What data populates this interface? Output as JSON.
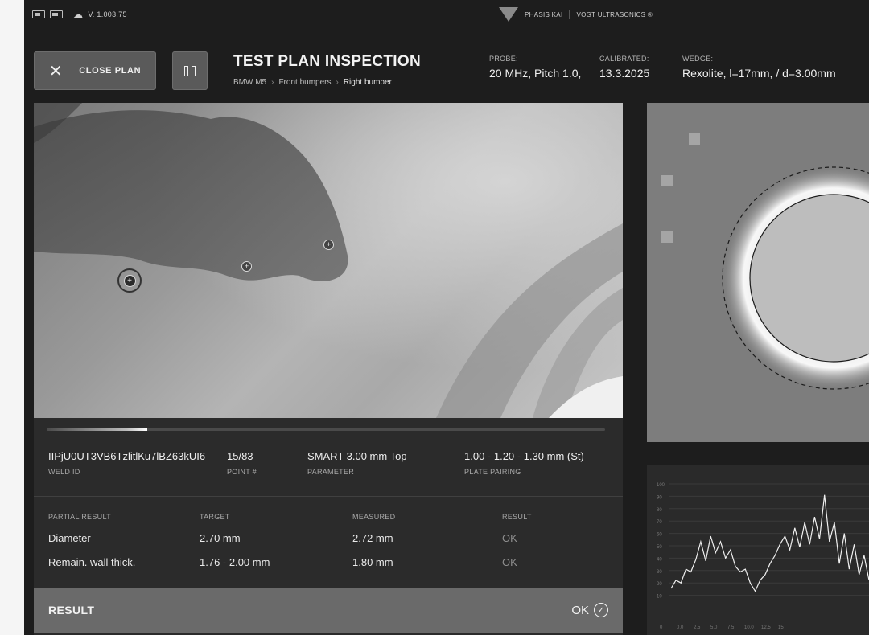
{
  "status_bar": {
    "version": "V. 1.003.75",
    "brand_app": "PHASIS KAI",
    "brand_company": "VOGT ULTRASONICS ®"
  },
  "header": {
    "close_label": "CLOSE PLAN",
    "title": "TEST PLAN INSPECTION",
    "breadcrumb": [
      "BMW M5",
      "Front bumpers",
      "Right bumper"
    ],
    "probe_label": "PROBE:",
    "probe_value": "20 MHz, Pitch 1.0,",
    "calibrated_label": "CALIBRATED:",
    "calibrated_value": "13.3.2025",
    "wedge_label": "WEDGE:",
    "wedge_value": "Rexolite, l=17mm, / d=3.00mm"
  },
  "weld_info": {
    "weld_id": "IIPjU0UT3VB6TzlitlKu7lBZ63kUI6",
    "weld_id_label": "WELD ID",
    "point": "15/83",
    "point_label": "POINT #",
    "parameter": "SMART 3.00 mm Top",
    "parameter_label": "PARAMETER",
    "plate_pairing": "1.00 - 1.20 - 1.30 mm (St)",
    "plate_pairing_label": "PLATE PAIRING",
    "progress": 0.18
  },
  "partial_results": {
    "headers": [
      "PARTIAL RESULT",
      "TARGET",
      "MEASURED",
      "RESULT"
    ],
    "rows": [
      {
        "name": "Diameter",
        "target": "2.70 mm",
        "measured": "2.72 mm",
        "result": "OK"
      },
      {
        "name": "Remain. wall thick.",
        "target": "1.76 - 2.00 mm",
        "measured": "1.80 mm",
        "result": "OK"
      }
    ]
  },
  "result": {
    "label": "RESULT",
    "value": "OK"
  },
  "graph": {
    "y_ticks": [
      "100",
      "90",
      "80",
      "70",
      "60",
      "50",
      "40",
      "30",
      "20",
      "10"
    ],
    "x_ticks": [
      "0",
      "0.0",
      "2.5",
      "5.0",
      "7.5",
      "10.0",
      "12.5",
      "15"
    ],
    "series": [
      24,
      30,
      28,
      38,
      36,
      45,
      58,
      44,
      62,
      50,
      58,
      46,
      52,
      40,
      36,
      38,
      28,
      22,
      30,
      34,
      42,
      48,
      56,
      62,
      52,
      68,
      54,
      72,
      56,
      76,
      60,
      92,
      58,
      72,
      42,
      64,
      38,
      56,
      34,
      48,
      30
    ]
  },
  "colors": {
    "app_bg": "#1d1d1d",
    "panel_bg": "#2b2b2b",
    "button_bg": "#5a5a5a",
    "result_bar_bg": "#6a6a6a"
  }
}
